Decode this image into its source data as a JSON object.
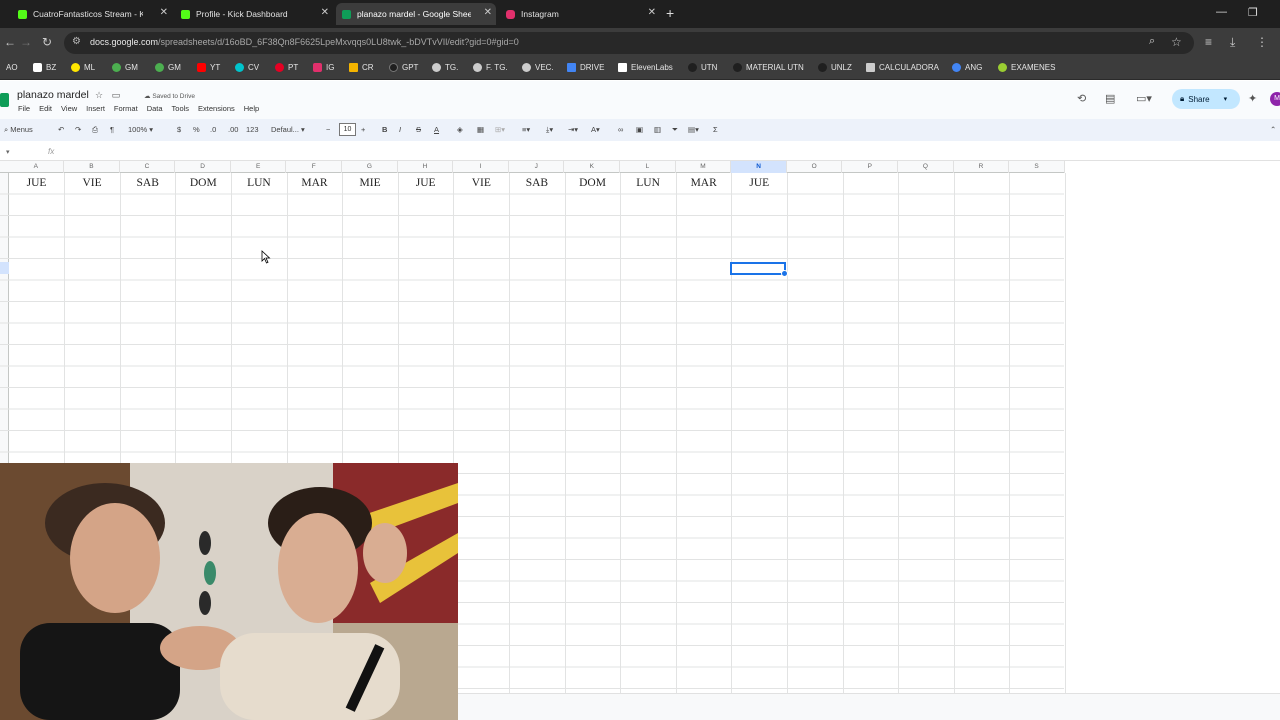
{
  "browser": {
    "tabs": [
      {
        "label": "CuatroFantasticos Stream - Kick",
        "favicon_color": "#53fc18",
        "active": false
      },
      {
        "label": "Profile - Kick Dashboard",
        "favicon_color": "#53fc18",
        "active": false
      },
      {
        "label": "planazo mardel - Google Sheets",
        "favicon_color": "#0f9d58",
        "active": true
      },
      {
        "label": "Instagram",
        "favicon_color": "#e1306c",
        "active": false
      }
    ],
    "url_main": "docs.google.com",
    "url_path": "/spreadsheets/d/16oBD_6F38Qn8F6625LpeMxvqqs0LU8twk_-bDVTvVIl/edit?gid=0#gid=0",
    "bookmarks": [
      {
        "label": "AO",
        "color": "#888888"
      },
      {
        "label": "BZ",
        "color": "#ffffff"
      },
      {
        "label": "ML",
        "color": "#ffe600"
      },
      {
        "label": "GM",
        "color": "#4caf50"
      },
      {
        "label": "GM",
        "color": "#4caf50"
      },
      {
        "label": "YT",
        "color": "#ff0000"
      },
      {
        "label": "CV",
        "color": "#00c4cc"
      },
      {
        "label": "PT",
        "color": "#e60023"
      },
      {
        "label": "IG",
        "color": "#e1306c"
      },
      {
        "label": "CR",
        "color": "#f4b400"
      },
      {
        "label": "GPT",
        "color": "#1f1f1f"
      },
      {
        "label": "TG.",
        "color": "#cccccc"
      },
      {
        "label": "F. TG.",
        "color": "#cccccc"
      },
      {
        "label": "VEC.",
        "color": "#cccccc"
      },
      {
        "label": "DRIVE",
        "color": "#4285f4"
      },
      {
        "label": "ElevenLabs",
        "color": "#ffffff"
      },
      {
        "label": "UTN",
        "color": "#1f1f1f"
      },
      {
        "label": "MATERIAL UTN",
        "color": "#1f1f1f"
      },
      {
        "label": "UNLZ",
        "color": "#1f1f1f"
      },
      {
        "label": "CALCULADORA",
        "color": "#cccccc"
      },
      {
        "label": "ANG",
        "color": "#4285f4"
      },
      {
        "label": "EXAMENES",
        "color": "#9acd32"
      }
    ]
  },
  "sheets": {
    "title": "planazo mardel",
    "saved_status": "Saved to Drive",
    "menu": [
      "File",
      "Edit",
      "View",
      "Insert",
      "Format",
      "Data",
      "Tools",
      "Extensions",
      "Help"
    ],
    "share_label": "Share",
    "avatar_letter": "M",
    "toolbar": {
      "menus_label": "Menus",
      "zoom": "100%",
      "currency": "$",
      "percent": "%",
      "dec_less": ".0",
      "dec_more": ".00",
      "number_format": "123",
      "font": "Defaul...",
      "font_size": "10"
    },
    "formula_label": "fx",
    "columns": [
      "A",
      "B",
      "C",
      "D",
      "E",
      "F",
      "G",
      "H",
      "I",
      "J",
      "K",
      "L",
      "M",
      "N",
      "O",
      "P",
      "Q",
      "R",
      "S"
    ],
    "selected_column": "N",
    "row1": [
      "JUE",
      "VIE",
      "SAB",
      "DOM",
      "LUN",
      "MAR",
      "MIE",
      "JUE",
      "VIE",
      "SAB",
      "DOM",
      "LUN",
      "MAR",
      "JUE"
    ]
  },
  "colors": {
    "sheets_green": "#0f9d58",
    "selection_blue": "#1a73e8",
    "share_bg": "#c2e7ff"
  }
}
